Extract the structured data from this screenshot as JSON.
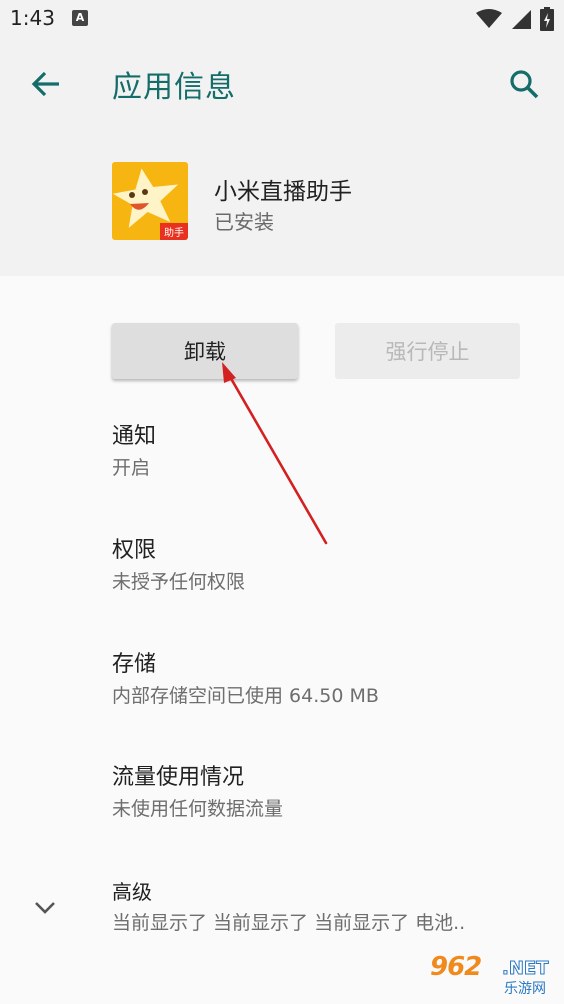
{
  "status_bar": {
    "time": "1:43",
    "badge": "A"
  },
  "app_bar": {
    "title": "应用信息"
  },
  "app": {
    "name": "小米直播助手",
    "status": "已安装",
    "icon_tag": "助手"
  },
  "buttons": {
    "uninstall": "卸载",
    "force_stop": "强行停止"
  },
  "items": [
    {
      "title": "通知",
      "subtitle": "开启"
    },
    {
      "title": "权限",
      "subtitle": "未授予任何权限"
    },
    {
      "title": "存储",
      "subtitle": "内部存储空间已使用 64.50 MB"
    },
    {
      "title": "流量使用情况",
      "subtitle": "未使用任何数据流量"
    },
    {
      "title": "高级",
      "subtitle": "当前显示了 当前显示了 当前显示了 电池.."
    }
  ],
  "watermark": {
    "main": "962",
    "net": ".NET",
    "sub": "乐游网"
  },
  "colors": {
    "accent": "#156d6a",
    "annotation_arrow": "#d32020",
    "app_icon_bg": "#f7b511"
  },
  "icons": {
    "back": "arrow-left-icon",
    "search": "search-icon",
    "expand": "chevron-down-icon"
  }
}
